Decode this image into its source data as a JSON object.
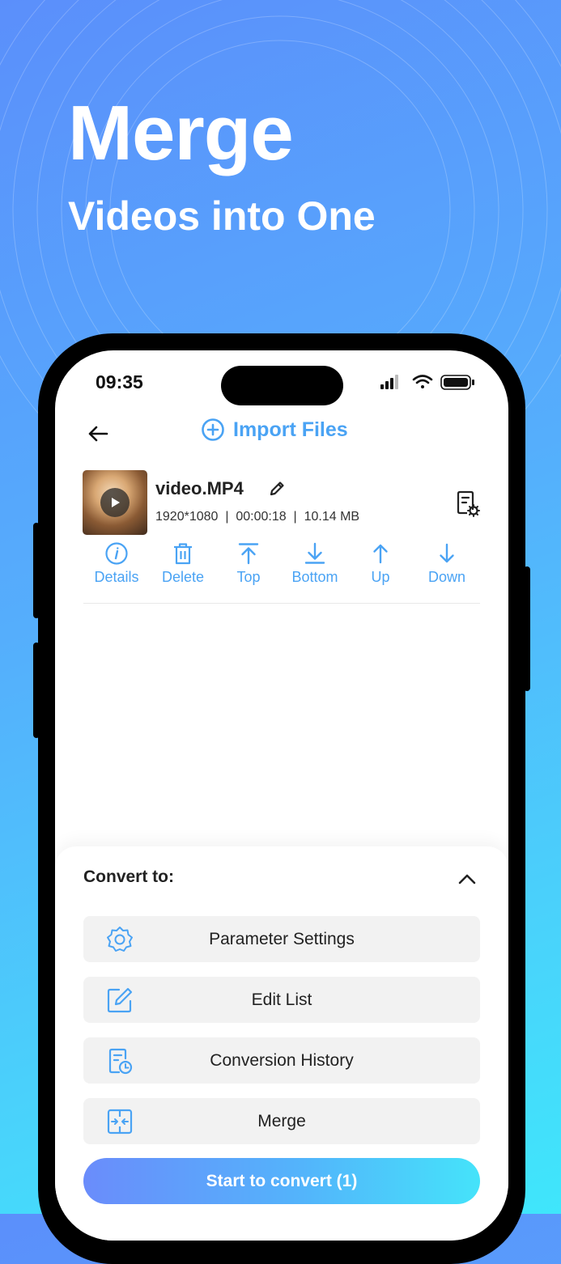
{
  "hero": {
    "title": "Merge",
    "subtitle": "Videos into One"
  },
  "status_bar": {
    "time": "09:35",
    "icons": [
      "signal-icon",
      "wifi-icon",
      "battery-icon"
    ]
  },
  "nav": {
    "back_icon": "back-arrow-icon",
    "import_label": "Import Files",
    "import_icon": "plus-circle-icon"
  },
  "file": {
    "name": "video.MP4",
    "resolution": "1920*1080",
    "duration": "00:00:18",
    "size": "10.14 MB"
  },
  "actions": [
    {
      "label": "Details",
      "icon": "info-icon"
    },
    {
      "label": "Delete",
      "icon": "trash-icon"
    },
    {
      "label": "Top",
      "icon": "arrow-to-top-icon"
    },
    {
      "label": "Bottom",
      "icon": "arrow-to-bottom-icon"
    },
    {
      "label": "Up",
      "icon": "arrow-up-icon"
    },
    {
      "label": "Down",
      "icon": "arrow-down-icon"
    }
  ],
  "sheet": {
    "convert_label": "Convert to:",
    "options": [
      {
        "label": "Parameter Settings",
        "icon": "gear-icon"
      },
      {
        "label": "Edit List",
        "icon": "edit-list-icon"
      },
      {
        "label": "Conversion History",
        "icon": "history-icon"
      },
      {
        "label": "Merge",
        "icon": "merge-icon"
      }
    ],
    "start_label": "Start to convert (1)"
  },
  "colors": {
    "accent": "#4aa3f4",
    "background_start": "#5b8ffb",
    "background_end": "#3fe6fb"
  }
}
